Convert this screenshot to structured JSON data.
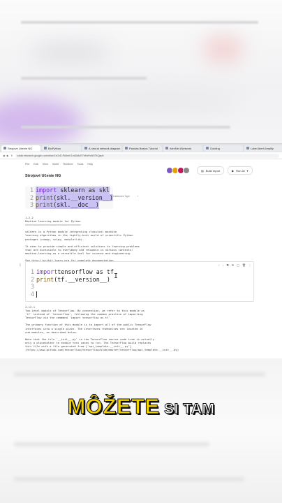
{
  "browser": {
    "tabs": [
      {
        "label": "Strojové Učenie NG"
      },
      {
        "label": "BioPython"
      },
      {
        "label": "A neural network diagram"
      },
      {
        "label": "Pandas Basics Tutorial"
      },
      {
        "label": "AlexNet (Network"
      },
      {
        "label": "Guiding"
      },
      {
        "label": "Label Alert Amplify"
      },
      {
        "label": "Website Performance"
      }
    ],
    "url": "colab.research.google.com/drive/1xGvD-PA5mK1ml2k8uR7bHzRoNSTkQaph"
  },
  "notebook": {
    "menu": [
      "File",
      "Edit",
      "View",
      "Insert",
      "Runtime",
      "Tools",
      "Help"
    ],
    "title": "Strojové Učenie NG",
    "build_report": "Build report",
    "run_all": "Run all",
    "toolbar": [
      "Komentár",
      "Informácie",
      "Complete Schema",
      "Appearance",
      "Dependencies Type",
      "+"
    ]
  },
  "cell1": {
    "lines": [
      {
        "n": "1",
        "kw": "import",
        "rest": " sklearn as skl"
      },
      {
        "n": "2",
        "kw": "print",
        "rest": "(skl.__version__)"
      },
      {
        "n": "3",
        "kw": "print",
        "rest": "(skl.__doc__)"
      }
    ],
    "output": "1.2.2\nMachine learning module for Python\n==================================\n\nsklearn is a Python module integrating classical machine\nlearning algorithms in the tightly-knit world of scientific Python\npackages (numpy, scipy, matplotlib).\n\nIt aims to provide simple and efficient solutions to learning problems\nthat are accessible to everybody and reusable in various contexts:\nmachine-learning as a versatile tool for science and engineering.\n\nSee http://scikit-learn.org for complete documentation."
  },
  "cell2": {
    "gutter": "[ ]",
    "lines": [
      {
        "n": "1",
        "kw": "import",
        "rest": " tensorflow as tf"
      },
      {
        "n": "2",
        "kw": "print",
        "rest": "(tf.__version__)"
      },
      {
        "n": "3",
        "kw": "",
        "rest": ""
      },
      {
        "n": "4",
        "kw": "",
        "rest": ""
      }
    ],
    "output": "2.12.1\nTop-level module of TensorFlow. By convention, we refer to this module as\n`tf` instead of `tensorflow`, following the common practice of importing\nTensorFlow via the command `import tensorflow as tf`.\n\nThe primary function of this module is to import all of the public TensorFlow\ninterfaces into a single place. The interfaces themselves are located in\nsub-modules, as described below.\n\nNote that the file `__init__.py` in the TensorFlow source code tree is actually\nonly a placeholder to enable test cases to run. The TensorFlow build replaces\nthis file with a file generated from [`api_template.__init__.py`]\n(https://www.github.com/tensorflow/tensorflow/blob/master/tensorflow/api_template.__init__.py)"
  },
  "caption": {
    "highlight": "MÔŽETE",
    "rest": " SI TAM"
  },
  "colors": {
    "caption_yellow": "#f4d200",
    "selection": "#c9c2f2",
    "keyword": "#7b30d0"
  }
}
